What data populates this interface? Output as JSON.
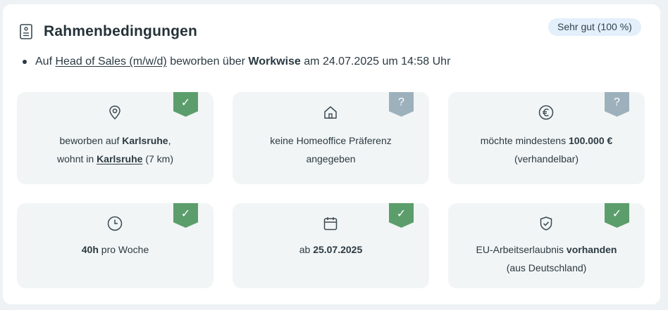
{
  "section": {
    "title": "Rahmenbedingungen",
    "rating_badge": "Sehr gut (100 %)"
  },
  "application": {
    "prefix": "Auf",
    "job_link": "Head of Sales (m/w/d)",
    "via_text": "beworben über",
    "platform": "Workwise",
    "date_text": "am 24.07.2025 um 14:58 Uhr"
  },
  "tiles": {
    "location": {
      "icon": "location-pin-icon",
      "status": "ok",
      "status_glyph": "✓",
      "line1_a": "beworben auf",
      "line1_b": "Karlsruhe",
      "line1_c": ",",
      "line2_a": "wohnt in",
      "line2_b": "Karlsruhe",
      "line2_c": "(7 km)"
    },
    "homeoffice": {
      "icon": "home-icon",
      "status": "unknown",
      "status_glyph": "?",
      "line1": "keine Homeoffice Präferenz",
      "line2": "angegeben"
    },
    "salary": {
      "icon": "euro-icon",
      "status": "unknown",
      "status_glyph": "?",
      "line1_a": "möchte mindestens",
      "line1_b": "100.000 €",
      "line2": "(verhandelbar)"
    },
    "hours": {
      "icon": "clock-icon",
      "status": "ok",
      "status_glyph": "✓",
      "value": "40h",
      "suffix": "pro Woche"
    },
    "start": {
      "icon": "calendar-icon",
      "status": "ok",
      "status_glyph": "✓",
      "prefix": "ab",
      "value": "25.07.2025"
    },
    "permit": {
      "icon": "shield-check-icon",
      "status": "ok",
      "status_glyph": "✓",
      "line1_a": "EU-Arbeitserlaubnis",
      "line1_b": "vorhanden",
      "line2": "(aus Deutschland)"
    }
  },
  "colors": {
    "ok": "#5b9e6c",
    "unknown": "#9db1bd",
    "tile_bg": "#f2f5f6",
    "badge_bg": "#e3effb"
  }
}
